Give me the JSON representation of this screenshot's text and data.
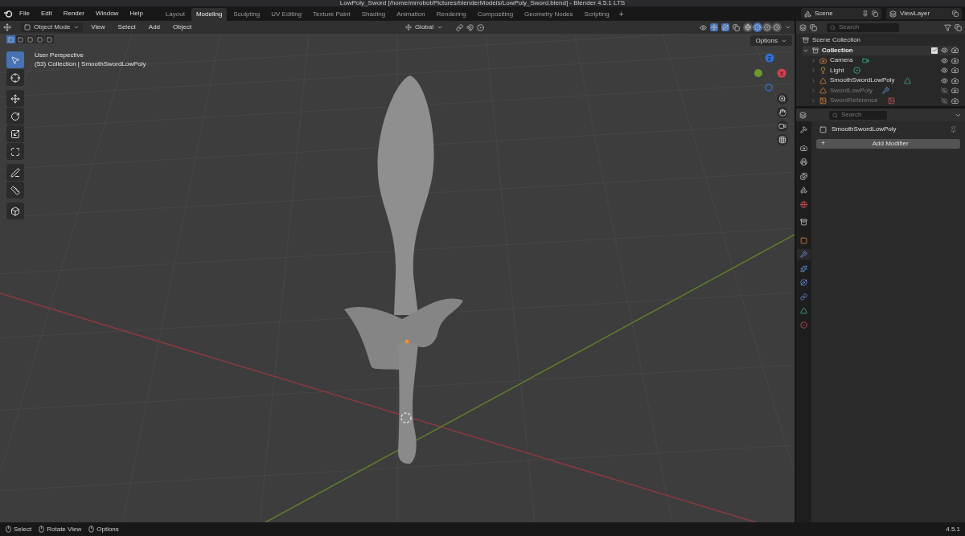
{
  "window": {
    "title": "LowPoly_Sword [/home/mrrobot/Pictures/blenderModels/LowPoly_Sword.blend] - Blender 4.5.1 LTS"
  },
  "menu": [
    "File",
    "Edit",
    "Render",
    "Window",
    "Help"
  ],
  "workspaces": [
    {
      "label": "Layout",
      "selected": false
    },
    {
      "label": "Modeling",
      "selected": true
    },
    {
      "label": "Sculpting",
      "selected": false
    },
    {
      "label": "UV Editing",
      "selected": false
    },
    {
      "label": "Texture Paint",
      "selected": false
    },
    {
      "label": "Shading",
      "selected": false
    },
    {
      "label": "Animation",
      "selected": false
    },
    {
      "label": "Rendering",
      "selected": false
    },
    {
      "label": "Compositing",
      "selected": false
    },
    {
      "label": "Geometry Nodes",
      "selected": false
    },
    {
      "label": "Scripting",
      "selected": false
    }
  ],
  "add_workspace": "+",
  "scene": "Scene",
  "view_layer": "ViewLayer",
  "viewport_header": {
    "mode": "Object Mode",
    "menus": [
      "View",
      "Select",
      "Add",
      "Object"
    ],
    "orientation": "Global",
    "options": "Options",
    "shading": [
      {
        "kind": "wireframe",
        "selected": false
      },
      {
        "kind": "solid",
        "selected": true
      },
      {
        "kind": "material",
        "selected": false
      },
      {
        "kind": "rendered",
        "selected": false
      }
    ]
  },
  "select_modes": [
    {
      "selected": true
    },
    {
      "selected": false
    },
    {
      "selected": false
    },
    {
      "selected": false
    },
    {
      "selected": false
    }
  ],
  "viewport": {
    "perspective": "User Perspective",
    "info": "(53) Collection | SmoothSwordLowPoly",
    "gizmo": [
      {
        "axis": "Z",
        "color": "#2f6fd6"
      },
      {
        "axis": "X",
        "color": "#d6404f"
      }
    ]
  },
  "tools": [
    {
      "kind": "select",
      "selected": true
    },
    {
      "kind": "cursor",
      "selected": false
    },
    {
      "kind": "move",
      "selected": false
    },
    {
      "kind": "rotate",
      "selected": false
    },
    {
      "kind": "scale",
      "selected": false
    },
    {
      "kind": "transform",
      "selected": false
    },
    {
      "kind": "annotate",
      "selected": false
    },
    {
      "kind": "measure",
      "selected": false
    },
    {
      "kind": "add_cube",
      "selected": false
    }
  ],
  "outliner": {
    "search": {
      "placeholder": "Search"
    },
    "root": "Scene Collection",
    "collection": {
      "name": "Collection",
      "expanded": true,
      "checked": true,
      "children": [
        {
          "name": "Camera",
          "kind": "camera",
          "visible": true
        },
        {
          "name": "Light",
          "kind": "light",
          "visible": true
        },
        {
          "name": "SmoothSwordLowPoly",
          "kind": "mesh",
          "visible": true
        },
        {
          "name": "SwordLowPoly",
          "kind": "mesh_mod",
          "visible": false
        },
        {
          "name": "SwordReference",
          "visible": false
        }
      ]
    }
  },
  "properties": {
    "search": {
      "placeholder": "Search"
    },
    "object": "SmoothSwordLowPoly",
    "add_modifier": {
      "icon": "+",
      "label": "Add Modifier"
    },
    "tabs": [
      {
        "kind": "tool",
        "selected": false
      },
      {
        "kind": "render",
        "selected": false
      },
      {
        "kind": "output",
        "selected": false
      },
      {
        "kind": "view_layer",
        "selected": false
      },
      {
        "kind": "scene",
        "selected": false
      },
      {
        "kind": "world",
        "selected": false
      },
      {
        "kind": "collection",
        "selected": false
      },
      {
        "kind": "object",
        "selected": false
      },
      {
        "kind": "modifiers",
        "selected": true
      },
      {
        "kind": "particles",
        "selected": false
      },
      {
        "kind": "physics",
        "selected": false
      },
      {
        "kind": "constraints",
        "selected": false
      },
      {
        "kind": "data",
        "selected": false
      },
      {
        "kind": "material",
        "selected": false
      }
    ]
  },
  "status_bar": {
    "hints": [
      "Select",
      "Rotate View",
      "Options"
    ],
    "version": "4.5.1"
  }
}
